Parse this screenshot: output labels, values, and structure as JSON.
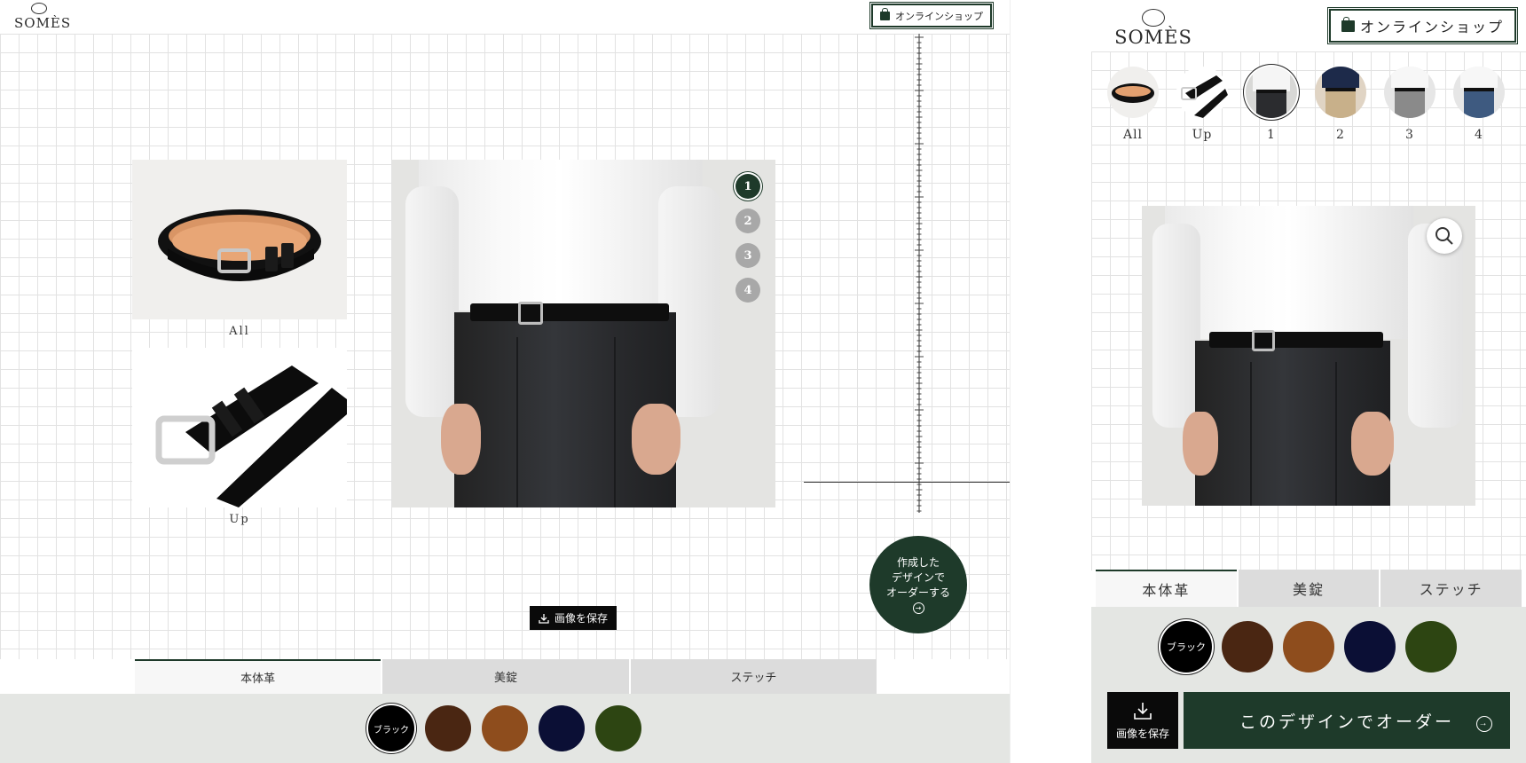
{
  "brand": {
    "logo_text": "SOMÈS"
  },
  "header": {
    "shop_label": "オンラインショップ"
  },
  "desktop": {
    "thumbnails": [
      {
        "caption": "All"
      },
      {
        "caption": "Up"
      }
    ],
    "number_buttons": [
      "1",
      "2",
      "3",
      "4"
    ],
    "order_button": {
      "line1": "作成した",
      "line2": "デザインで",
      "line3": "オーダーする"
    },
    "save_label": "画像を保存"
  },
  "tabs": [
    "本体革",
    "美錠",
    "ステッチ"
  ],
  "swatches": [
    {
      "label": "ブラック",
      "color": "#000000"
    },
    {
      "label": "",
      "color": "#4a2612"
    },
    {
      "label": "",
      "color": "#8e4d1d"
    },
    {
      "label": "",
      "color": "#0b0f35"
    },
    {
      "label": "",
      "color": "#2d4512"
    }
  ],
  "mobile": {
    "view_thumbs": [
      "All",
      "Up",
      "1",
      "2",
      "3",
      "4"
    ],
    "save_label": "画像を保存",
    "order_label": "このデザインでオーダー"
  },
  "colors": {
    "accent": "#1e3a2a",
    "panel": "#e4e6e3"
  }
}
